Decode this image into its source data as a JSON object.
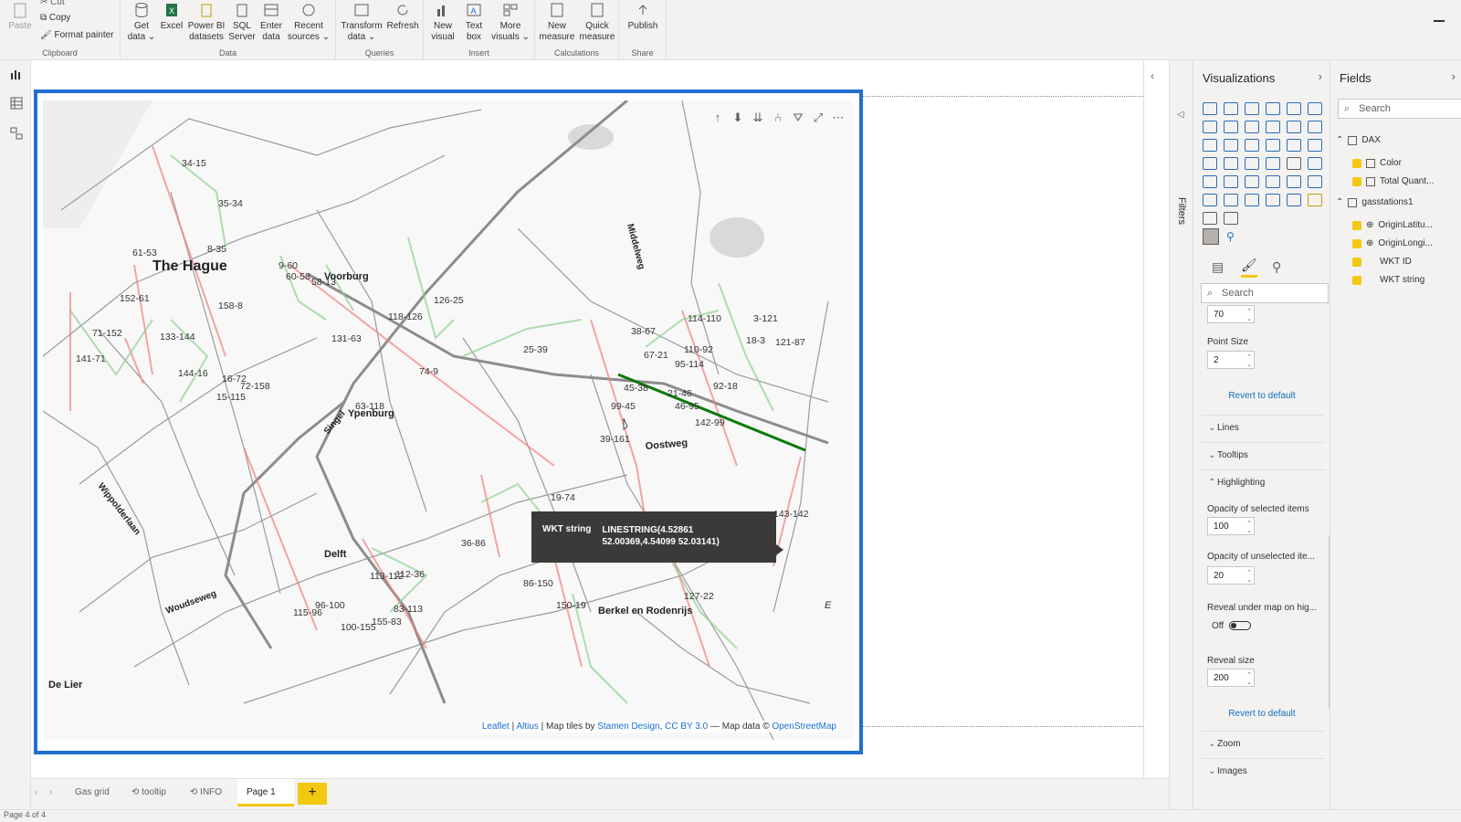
{
  "ribbon": {
    "groups": [
      {
        "name": "Clipboard",
        "buttons": [
          {
            "label": "Paste"
          },
          {
            "label": "Cut"
          },
          {
            "label": "Copy"
          },
          {
            "label": "Format painter"
          }
        ]
      },
      {
        "name": "Data",
        "buttons": [
          {
            "label": "Get data ⌄"
          },
          {
            "label": "Excel"
          },
          {
            "label": "Power BI datasets"
          },
          {
            "label": "SQL Server"
          },
          {
            "label": "Enter data"
          },
          {
            "label": "Recent sources ⌄"
          }
        ]
      },
      {
        "name": "Queries",
        "buttons": [
          {
            "label": "Transform data ⌄"
          },
          {
            "label": "Refresh"
          }
        ]
      },
      {
        "name": "Insert",
        "buttons": [
          {
            "label": "New visual"
          },
          {
            "label": "Text box"
          },
          {
            "label": "More visuals ⌄"
          }
        ]
      },
      {
        "name": "Calculations",
        "buttons": [
          {
            "label": "New measure"
          },
          {
            "label": "Quick measure"
          }
        ]
      },
      {
        "name": "Share",
        "buttons": [
          {
            "label": "Publish"
          }
        ]
      }
    ]
  },
  "map": {
    "places": [
      "The Hague",
      "Voorburg",
      "Ypenburg",
      "Delft",
      "Berkel en Rodenrijs",
      "De Lier",
      "Oostweg",
      "Middelweg",
      "Wippolderlaan",
      "Woudseweg",
      "Singel"
    ],
    "labels": [
      "34-15",
      "35-34",
      "61-53",
      "8-35",
      "9-60",
      "60-58",
      "58-13",
      "152-61",
      "158-8",
      "71-152",
      "133-144",
      "141-71",
      "144-16",
      "16-72",
      "72-158",
      "15-115",
      "131-63",
      "118-126",
      "126-25",
      "74-9",
      "63-118",
      "25-39",
      "38-67",
      "114-110",
      "3-121",
      "18-3",
      "121-87",
      "110-92",
      "67-21",
      "95-114",
      "92-18",
      "45-38",
      "21-46",
      "99-45",
      "46-95",
      "142-99",
      "39-161",
      "19-74",
      "143-142",
      "36-86",
      "113-112",
      "112-36",
      "86-150",
      "150-19",
      "127-22",
      "96-100",
      "115-96",
      "83-113",
      "100-155",
      "155-83"
    ],
    "tooltip": {
      "key": "WKT string",
      "value": "LINESTRING(4.52861 52.00369,4.54099 52.03141)"
    },
    "attribution": {
      "leaflet": "Leaflet",
      "sep1": " | ",
      "altius": "Altius",
      "mid": " | Map tiles by ",
      "stamen": "Stamen Design",
      "comma": ", ",
      "ccby": "CC BY 3.0",
      "dash": " — Map data © ",
      "osm": "OpenStreetMap"
    },
    "e_label": "E",
    "colors": {
      "highlight": "#0a7a0a",
      "red": "#f08080",
      "green": "#8fcf8f",
      "road": "#9a9a9a"
    }
  },
  "filters": {
    "label": "Filters"
  },
  "visualizations": {
    "title": "Visualizations",
    "search_placeholder": "Search",
    "top_value": "70",
    "point_size_label": "Point Size",
    "point_size_value": "2",
    "revert_label": "Revert to default",
    "sections": [
      "Lines",
      "Tooltips",
      "Highlighting",
      "Zoom",
      "Images"
    ],
    "opacity_selected_label": "Opacity of selected items",
    "opacity_selected_value": "100",
    "opacity_unselected_label": "Opacity of unselected ite...",
    "opacity_unselected_value": "20",
    "reveal_label": "Reveal under map on hig...",
    "reveal_toggle": "Off",
    "reveal_size_label": "Reveal size",
    "reveal_size_value": "200"
  },
  "fields": {
    "title": "Fields",
    "search_placeholder": "Search",
    "tables": [
      {
        "name": "DAX",
        "items": [
          "Color",
          "Total Quant..."
        ]
      },
      {
        "name": "gasstations1",
        "items": [
          "OriginLatitu...",
          "OriginLongi...",
          "WKT ID",
          "WKT string"
        ]
      }
    ]
  },
  "tabs": {
    "items": [
      "Gas grid",
      "tooltip",
      "INFO",
      "Page 1"
    ],
    "add": "+"
  },
  "status": {
    "text": "Page 4 of 4"
  }
}
